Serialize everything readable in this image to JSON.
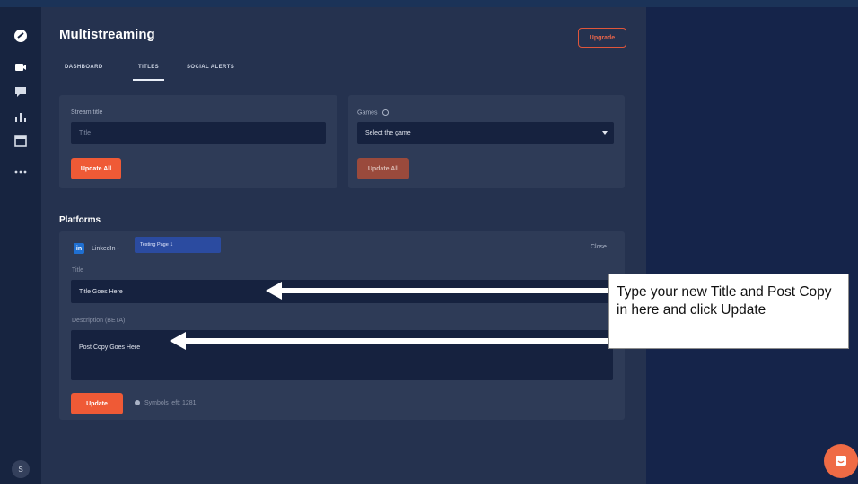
{
  "app": {
    "title": "Multistreaming",
    "upgrade_label": "Upgrade"
  },
  "rail": {
    "icons": [
      "logo-icon",
      "video-icon",
      "chat-icon",
      "chart-icon",
      "calendar-icon",
      "more-icon"
    ],
    "avatar_initial": "S"
  },
  "tabs": [
    {
      "label": "DASHBOARD",
      "active": false
    },
    {
      "label": "TITLES",
      "active": true
    },
    {
      "label": "SOCIAL ALERTS",
      "active": false
    }
  ],
  "stream_card": {
    "label": "Stream title",
    "placeholder": "Title",
    "button": "Update All"
  },
  "games_card": {
    "label": "Games",
    "select_value": "Select the game",
    "button": "Update All"
  },
  "platforms": {
    "heading": "Platforms",
    "platform_name": "LinkedIn",
    "page_chip": "Testing Page 1",
    "close_label": "Close",
    "title_label": "Title",
    "title_value": "Title Goes Here",
    "description_label": "Description (BETA)",
    "description_value": "Post Copy Goes Here",
    "update_label": "Update",
    "symbols_left": "Symbols left: 1281"
  },
  "annotation": {
    "text": "Type your new Title and Post Copy in here and click Update"
  },
  "colors": {
    "background": "#1b2847",
    "panel": "#25324f",
    "card": "#2e3b57",
    "accent": "#ef5a36",
    "field": "#16223f"
  }
}
